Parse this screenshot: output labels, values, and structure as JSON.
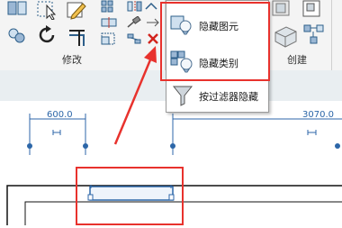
{
  "ribbon": {
    "panels": {
      "modify": "修改",
      "create": "创建"
    }
  },
  "dropdown_menu": {
    "items": [
      {
        "label": "隐藏图元",
        "icon": "hide-element-icon"
      },
      {
        "label": "隐藏类别",
        "icon": "hide-category-icon"
      },
      {
        "label": "按过滤器隐藏",
        "icon": "filter-funnel-icon"
      }
    ]
  },
  "dimensions": {
    "left": "600.0",
    "right": "3070.0"
  },
  "colors": {
    "highlight": "#e8322d",
    "dimension": "#2c66a8",
    "strip": "#e9eef1"
  }
}
